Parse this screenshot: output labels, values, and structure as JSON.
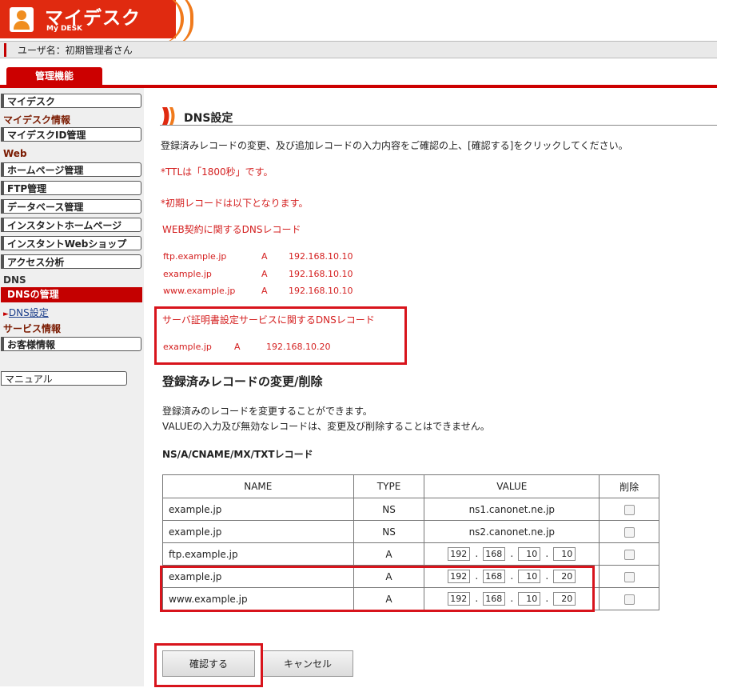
{
  "header": {
    "logo_title": "マイデスク",
    "logo_sub": "My DESK",
    "user_label": "ユーザ名：初期管理者さん",
    "main_tab": "管理機能"
  },
  "sidebar": {
    "mydesk": "マイデスク",
    "sec_mydesk_info": "マイデスク情報",
    "mydesk_id": "マイデスクID管理",
    "sec_web": "Web",
    "homepage": "ホームページ管理",
    "ftp": "FTP管理",
    "database": "データベース管理",
    "instant_hp": "インスタントホームページ",
    "instant_shop": "インスタントWebショップ",
    "access": "アクセス分析",
    "sec_dns": "DNS",
    "dns_manage": "DNSの管理",
    "dns_settings": "DNS設定",
    "sec_service": "サービス情報",
    "customer": "お客様情報",
    "manual": "マニュアル"
  },
  "main": {
    "title": "DNS設定",
    "intro": "登録済みレコードの変更、及び追加レコードの入力内容をご確認の上、[確認する]をクリックしてください。",
    "ttl_note": "*TTLは「1800秒」です。",
    "initial_note": "*初期レコードは以下となります。",
    "web_heading": "WEB契約に関するDNSレコード",
    "web_records": [
      {
        "name": "ftp.example.jp",
        "type": "A",
        "value": "192.168.10.10"
      },
      {
        "name": "example.jp",
        "type": "A",
        "value": "192.168.10.10"
      },
      {
        "name": "www.example.jp",
        "type": "A",
        "value": "192.168.10.10"
      }
    ],
    "cert_heading": "サーバ証明書設定サービスに関するDNSレコード",
    "cert_record": {
      "name": "example.jp",
      "type": "A",
      "value": "192.168.10.20"
    },
    "change_heading": "登録済みレコードの変更/削除",
    "change_desc1": "登録済みのレコードを変更することができます。",
    "change_desc2": "VALUEの入力及び無効なレコードは、変更及び削除することはできません。",
    "record_types": "NS/A/CNAME/MX/TXTレコード",
    "table": {
      "headers": [
        "NAME",
        "TYPE",
        "VALUE",
        "削除"
      ],
      "rows": [
        {
          "name": "example.jp",
          "type": "NS",
          "value": "ns1.canonet.ne.jp"
        },
        {
          "name": "example.jp",
          "type": "NS",
          "value": "ns2.canonet.ne.jp"
        },
        {
          "name": "ftp.example.jp",
          "type": "A",
          "ip": [
            "192",
            "168",
            "10",
            "10"
          ]
        },
        {
          "name": "example.jp",
          "type": "A",
          "ip": [
            "192",
            "168",
            "10",
            "20"
          ]
        },
        {
          "name": "www.example.jp",
          "type": "A",
          "ip": [
            "192",
            "168",
            "10",
            "20"
          ]
        }
      ]
    },
    "confirm_button": "確認する",
    "cancel_button": "キャンセル"
  },
  "colors": {
    "brand_red": "#cc0000",
    "logo_orange": "#f07a1c",
    "note_red": "#d42020",
    "highlight": "#d8141c"
  }
}
